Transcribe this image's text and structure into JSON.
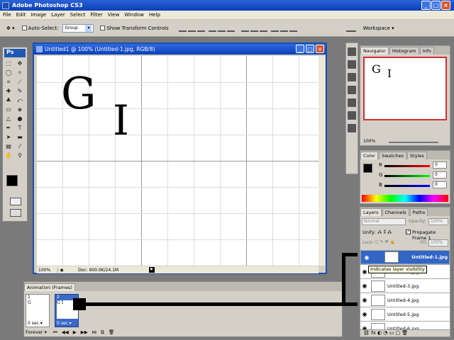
{
  "app": {
    "title": "Adobe Photoshop CS3"
  },
  "menu": [
    "File",
    "Edit",
    "Image",
    "Layer",
    "Select",
    "Filter",
    "View",
    "Window",
    "Help"
  ],
  "options": {
    "auto_select_label": "Auto-Select:",
    "auto_select_value": "Group",
    "show_transform_label": "Show Transform Controls",
    "workspace_label": "Workspace ▾"
  },
  "tools": {
    "header": "Ps"
  },
  "document": {
    "title": "Untitled1 @ 100% (Untitled-1.jpg, RGB/8)",
    "zoom": "100%",
    "doc_size": "Doc: 900.0K/24.1M",
    "text_g": "G",
    "text_i": "I"
  },
  "animation": {
    "tab": "Animation (Frames)",
    "frames": [
      {
        "num": "1",
        "delay": "0 sec.▾",
        "thumb": "G"
      },
      {
        "num": "2",
        "delay": "0 sec.▾",
        "thumb": "G I"
      }
    ],
    "loop": "Forever ▾"
  },
  "navigator": {
    "tabs": [
      "Navigator",
      "Histogram",
      "Info"
    ],
    "zoom": "100%",
    "preview_g": "G",
    "preview_i": "I"
  },
  "color": {
    "tabs": [
      "Color",
      "Swatches",
      "Styles"
    ],
    "channels": [
      {
        "label": "R",
        "value": "0"
      },
      {
        "label": "G",
        "value": "0"
      },
      {
        "label": "B",
        "value": "0"
      }
    ]
  },
  "layers": {
    "tabs": [
      "Layers",
      "Channels",
      "Paths"
    ],
    "blend": "Normal",
    "opacity_label": "Opacity:",
    "opacity": "100%",
    "unify_label": "Unify:",
    "propagate_label": "Propagate Frame 1",
    "lock_label": "Lock:",
    "fill_label": "Fill:",
    "fill": "100%",
    "items": [
      {
        "name": "Untitled-1.jpg"
      },
      {
        "name": "Untitled-2.jpg"
      },
      {
        "name": "Untitled-3.jpg"
      },
      {
        "name": "Untitled-4.jpg"
      },
      {
        "name": "Untitled-5.jpg"
      },
      {
        "name": "Untitled-6.jpg"
      }
    ],
    "tooltip": "Indicates layer visibility"
  },
  "colors": {
    "accent": "#0a3fb8",
    "selection": "#3265c4",
    "callout": "#000000"
  }
}
